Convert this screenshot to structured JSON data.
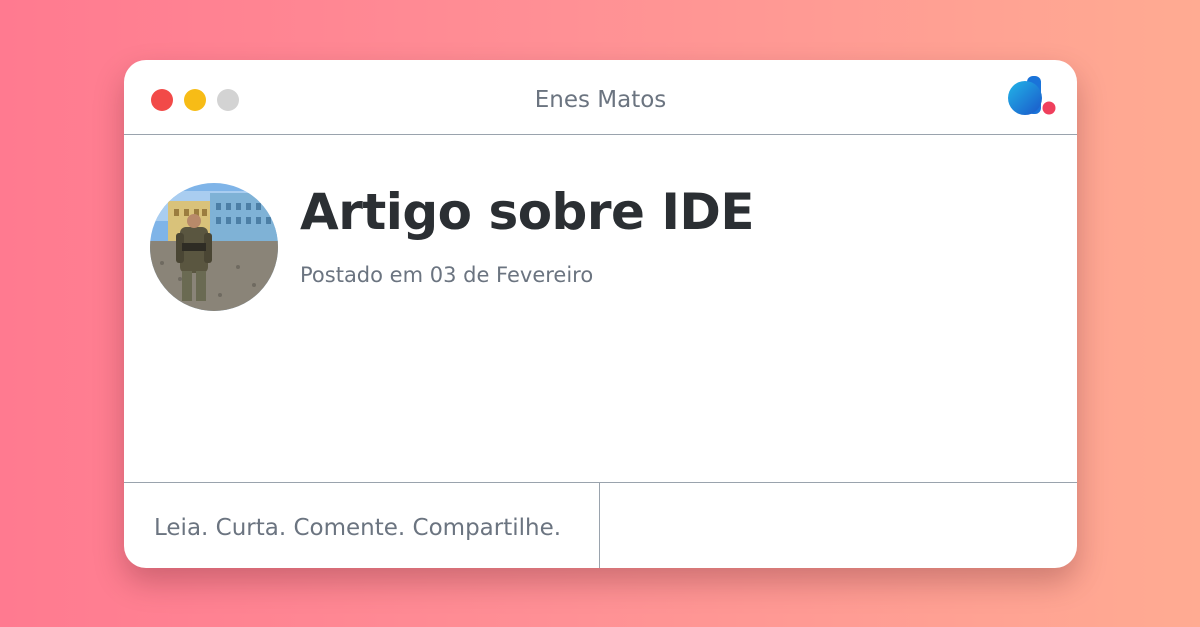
{
  "window": {
    "title": "Enes Matos",
    "controls": [
      "close",
      "minimize",
      "maximize"
    ],
    "logo_icon": "dev-logo-icon"
  },
  "post": {
    "title": "Artigo sobre IDE",
    "date": "Postado em 03 de Fevereiro",
    "avatar_icon": "author-avatar"
  },
  "footer": {
    "tagline": "Leia. Curta. Comente. Compartilhe."
  },
  "colors": {
    "background_start": "#ff7a90",
    "background_end": "#ffab92",
    "close": "#f24a48",
    "minimize": "#f7bc16",
    "maximize": "#d3d3d3",
    "logo_blue": "#1a73d9",
    "logo_cyan": "#22b5e8",
    "logo_dot": "#ef3f5c"
  }
}
